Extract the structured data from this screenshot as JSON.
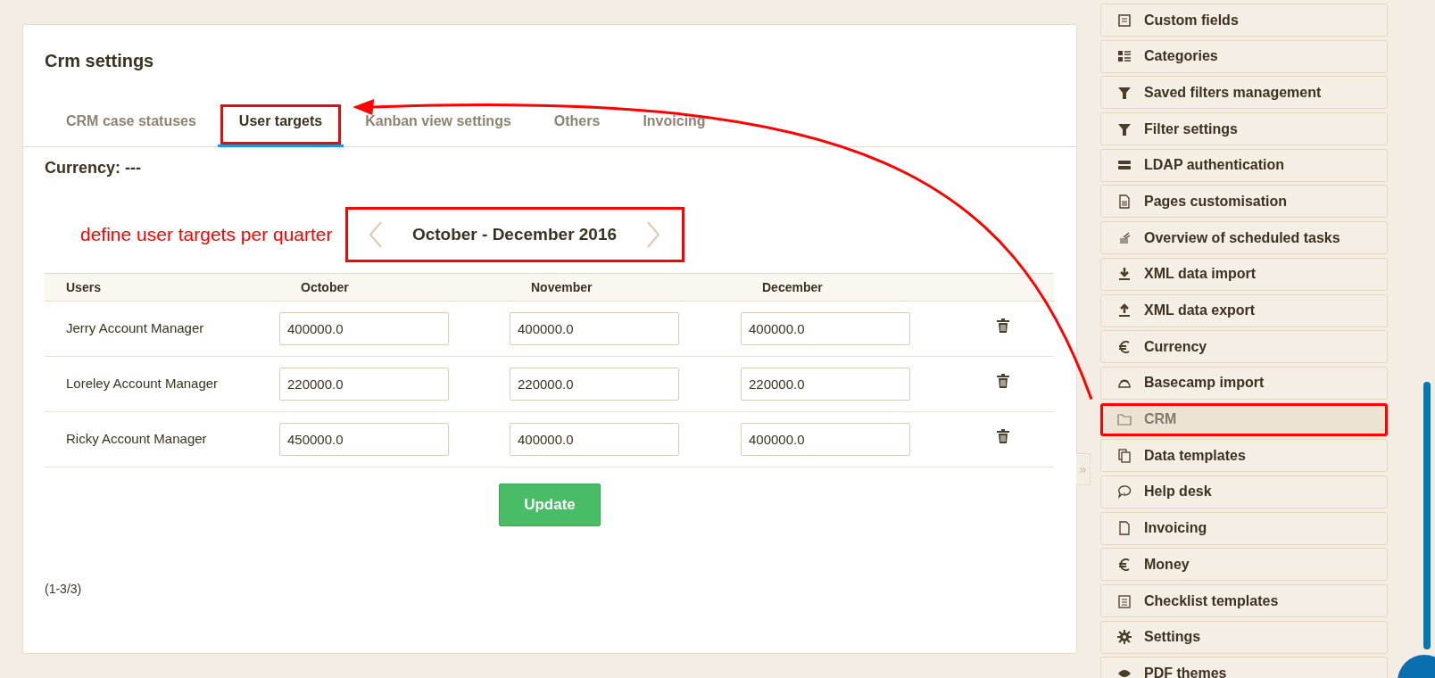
{
  "panel": {
    "title": "Crm settings",
    "tabs": [
      {
        "label": "CRM case statuses",
        "selected": false,
        "annotated": false
      },
      {
        "label": "User targets",
        "selected": true,
        "annotated": true
      },
      {
        "label": "Kanban view settings",
        "selected": false,
        "annotated": false
      },
      {
        "label": "Others",
        "selected": false,
        "annotated": false
      },
      {
        "label": "Invoicing",
        "selected": false,
        "annotated": false
      }
    ],
    "currency": "Currency: ---",
    "annotation_note": "define user targets per quarter",
    "period": {
      "label": "October - December 2016",
      "annotated": true
    },
    "table": {
      "columns": [
        "Users",
        "October",
        "November",
        "December"
      ],
      "rows": [
        {
          "user": "Jerry Account Manager",
          "values": [
            "400000.0",
            "400000.0",
            "400000.0"
          ]
        },
        {
          "user": "Loreley Account Manager",
          "values": [
            "220000.0",
            "220000.0",
            "220000.0"
          ]
        },
        {
          "user": "Ricky Account Manager",
          "values": [
            "450000.0",
            "400000.0",
            "400000.0"
          ]
        }
      ]
    },
    "update_button": "Update",
    "pagination": "(1-3/3)"
  },
  "collapse_toggle": "»",
  "sidebar": {
    "items": [
      {
        "label": "Custom fields",
        "selected": false,
        "annotated": false
      },
      {
        "label": "Categories",
        "selected": false,
        "annotated": false
      },
      {
        "label": "Saved filters management",
        "selected": false,
        "annotated": false
      },
      {
        "label": "Filter settings",
        "selected": false,
        "annotated": false
      },
      {
        "label": "LDAP authentication",
        "selected": false,
        "annotated": false
      },
      {
        "label": "Pages customisation",
        "selected": false,
        "annotated": false
      },
      {
        "label": "Overview of scheduled tasks",
        "selected": false,
        "annotated": false
      },
      {
        "label": "XML data import",
        "selected": false,
        "annotated": false
      },
      {
        "label": "XML data export",
        "selected": false,
        "annotated": false
      },
      {
        "label": "Currency",
        "selected": false,
        "annotated": false
      },
      {
        "label": "Basecamp import",
        "selected": false,
        "annotated": false
      },
      {
        "label": "CRM",
        "selected": true,
        "annotated": true
      },
      {
        "label": "Data templates",
        "selected": false,
        "annotated": false
      },
      {
        "label": "Help desk",
        "selected": false,
        "annotated": false
      },
      {
        "label": "Invoicing",
        "selected": false,
        "annotated": false
      },
      {
        "label": "Money",
        "selected": false,
        "annotated": false
      },
      {
        "label": "Checklist templates",
        "selected": false,
        "annotated": false
      },
      {
        "label": "Settings",
        "selected": false,
        "annotated": false
      },
      {
        "label": "PDF themes",
        "selected": false,
        "annotated": false
      }
    ]
  }
}
